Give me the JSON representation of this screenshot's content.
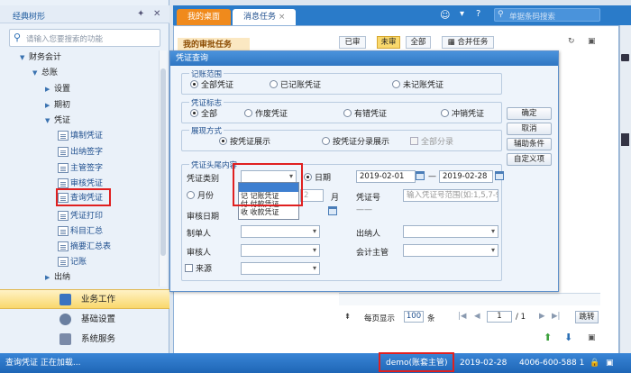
{
  "left_panel": {
    "title": "经典树形",
    "search_placeholder": "请输入您要搜索的功能",
    "tree": [
      {
        "label": "财务会计"
      },
      {
        "label": "总账"
      },
      {
        "label": "设置"
      },
      {
        "label": "期初"
      },
      {
        "label": "凭证"
      },
      {
        "label": "填制凭证"
      },
      {
        "label": "出纳签字"
      },
      {
        "label": "主管签字"
      },
      {
        "label": "审核凭证"
      },
      {
        "label": "查询凭证"
      },
      {
        "label": "凭证打印"
      },
      {
        "label": "科目汇总"
      },
      {
        "label": "摘要汇总表"
      },
      {
        "label": "记账"
      },
      {
        "label": "出纳"
      }
    ],
    "nav": [
      {
        "label": "业务工作",
        "color": "#3a73c0"
      },
      {
        "label": "基础设置",
        "color": "#6a7fa0"
      },
      {
        "label": "系统服务",
        "color": "#7a8aa8"
      }
    ]
  },
  "tabs": [
    {
      "label": "我的桌面"
    },
    {
      "label": "消息任务"
    }
  ],
  "top_search_placeholder": "单据条码搜索",
  "bg": {
    "title": "我的审批任务",
    "filters": [
      "已审",
      "未审",
      "全部"
    ],
    "merge_task": "合并任务"
  },
  "dialog": {
    "title": "凭证查询",
    "scope": {
      "label": "记账范围",
      "options": [
        "全部凭证",
        "已记账凭证",
        "未记账凭证"
      ]
    },
    "flag": {
      "label": "凭证标志",
      "options": [
        "全部",
        "作废凭证",
        "有错凭证",
        "冲销凭证"
      ]
    },
    "display": {
      "label": "展现方式",
      "options": [
        "按凭证展示",
        "按凭证分录展示"
      ],
      "check": "全部分录"
    },
    "head": {
      "label": "凭证头尾内容",
      "voucher_type": "凭证类别",
      "date_label": "日期",
      "date_from": "2019-02-01",
      "date_sep": "—",
      "date_to": "2019-02-28",
      "month_label": "月份",
      "month_value": "2",
      "month_unit": "月",
      "voucher_no": "凭证号",
      "voucher_no_placeholder": "输入凭证号范围(如:1,5,7-9",
      "voucher_no_dash": "——",
      "audit_date": "审核日期",
      "maker": "制单人",
      "cashier": "出纳人",
      "auditor": "审核人",
      "chief": "会计主管",
      "source": "来源"
    },
    "dropdown_options": [
      "记 记账凭证",
      "付 付款凭证",
      "收 收款凭证"
    ],
    "buttons": [
      "确定",
      "取消",
      "辅助条件",
      "自定义项"
    ]
  },
  "pager": {
    "per_page_label": "每页显示",
    "per_page": "100",
    "unit": "条",
    "page": "1",
    "total": "/ 1",
    "jump": "跳转"
  },
  "status": {
    "left": "查询凭证 正在加载...",
    "user": "demo(账套主管)",
    "date": "2019-02-28",
    "phone": "4006-600-588 1"
  }
}
